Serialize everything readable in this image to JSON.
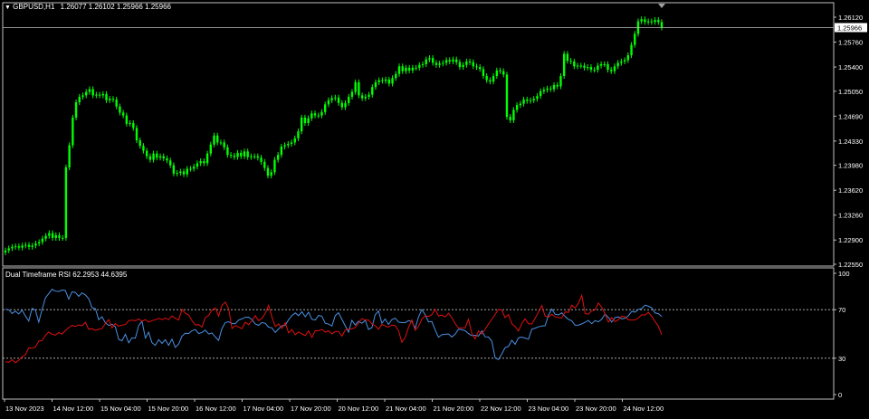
{
  "symbol_title": "GBPUSD,H1",
  "ohlc_text": "1.26077 1.26102 1.25966 1.25966",
  "price_axis_ticks": [
    "1.26120",
    "1.25760",
    "1.25400",
    "1.25050",
    "1.24690",
    "1.24330",
    "1.23980",
    "1.23620",
    "1.23260",
    "1.22900",
    "1.22550"
  ],
  "price_tick_values": [
    1.2612,
    1.2576,
    1.254,
    1.2505,
    1.2469,
    1.2433,
    1.2398,
    1.2362,
    1.2326,
    1.229,
    1.2255
  ],
  "current_price_label": "1.25966",
  "indicator_title": "Dual Timeframe RSI 62.2953 44.6395",
  "rsi_axis_ticks": [
    "100",
    "70",
    "30",
    "0"
  ],
  "time_axis_ticks": [
    "13 Nov 2023",
    "14 Nov 12:00",
    "15 Nov 04:00",
    "15 Nov 20:00",
    "16 Nov 12:00",
    "17 Nov 04:00",
    "17 Nov 20:00",
    "20 Nov 12:00",
    "21 Nov 04:00",
    "21 Nov 20:00",
    "22 Nov 12:00",
    "23 Nov 04:00",
    "23 Nov 20:00",
    "24 Nov 12:00"
  ],
  "colors": {
    "background": "#000000",
    "candles": "#00ff00",
    "rsi_fast": "#4a90e2",
    "rsi_slow": "#e01010",
    "grid": "#c0c0c0"
  },
  "chart_data": [
    {
      "type": "candlestick",
      "title": "GBPUSD,H1",
      "ylim": [
        1.2255,
        1.2625
      ],
      "x_range": [
        "13 Nov 2023",
        "24 Nov 2023"
      ],
      "close": [
        1.2275,
        1.2278,
        1.228,
        1.2281,
        1.2279,
        1.2282,
        1.2283,
        1.228,
        1.2282,
        1.2285,
        1.2287,
        1.2292,
        1.2296,
        1.23,
        1.2293,
        1.2297,
        1.2293,
        1.2293,
        1.2395,
        1.2427,
        1.2467,
        1.2489,
        1.2497,
        1.2499,
        1.2504,
        1.2508,
        1.2499,
        1.25,
        1.2499,
        1.2501,
        1.2492,
        1.2494,
        1.2493,
        1.2483,
        1.2474,
        1.247,
        1.2458,
        1.2459,
        1.2452,
        1.2434,
        1.2426,
        1.2419,
        1.2411,
        1.2406,
        1.2415,
        1.2409,
        1.2411,
        1.2408,
        1.2405,
        1.2398,
        1.2386,
        1.2387,
        1.2389,
        1.2385,
        1.2393,
        1.2393,
        1.2396,
        1.2401,
        1.2404,
        1.2401,
        1.2415,
        1.2428,
        1.2441,
        1.2431,
        1.2431,
        1.2424,
        1.2413,
        1.2412,
        1.241,
        1.2416,
        1.2411,
        1.2418,
        1.241,
        1.2411,
        1.2411,
        1.2409,
        1.2403,
        1.2394,
        1.2383,
        1.2388,
        1.2406,
        1.2413,
        1.2425,
        1.2427,
        1.2429,
        1.2431,
        1.2437,
        1.2447,
        1.2467,
        1.2459,
        1.2466,
        1.2473,
        1.247,
        1.247,
        1.2475,
        1.2486,
        1.2492,
        1.2495,
        1.2496,
        1.2488,
        1.2482,
        1.2488,
        1.2497,
        1.2504,
        1.2518,
        1.2499,
        1.2495,
        1.2497,
        1.25,
        1.2511,
        1.2518,
        1.2521,
        1.252,
        1.2522,
        1.2516,
        1.2524,
        1.253,
        1.2541,
        1.2534,
        1.2539,
        1.2535,
        1.2539,
        1.2539,
        1.2543,
        1.2544,
        1.2551,
        1.2553,
        1.2546,
        1.2543,
        1.2545,
        1.2546,
        1.255,
        1.2548,
        1.2551,
        1.2547,
        1.254,
        1.2543,
        1.2548,
        1.2547,
        1.2541,
        1.254,
        1.2537,
        1.2527,
        1.2521,
        1.2519,
        1.2527,
        1.2535,
        1.2534,
        1.2529,
        1.2468,
        1.2463,
        1.2478,
        1.2485,
        1.2487,
        1.2493,
        1.2491,
        1.2492,
        1.2494,
        1.2498,
        1.2505,
        1.2507,
        1.2509,
        1.2508,
        1.2514,
        1.2512,
        1.2527,
        1.2559,
        1.2549,
        1.2548,
        1.2541,
        1.2542,
        1.2542,
        1.2539,
        1.254,
        1.2536,
        1.2536,
        1.2542,
        1.2544,
        1.2544,
        1.2536,
        1.2534,
        1.2541,
        1.2546,
        1.2548,
        1.255,
        1.2557,
        1.2572,
        1.2588,
        1.2606,
        1.2609,
        1.2605,
        1.2606,
        1.2605,
        1.2608,
        1.2605,
        1.2597
      ]
    },
    {
      "type": "line",
      "title": "Dual Timeframe RSI 62.2953 44.6395",
      "ylim": [
        0,
        100
      ],
      "levels": [
        30,
        70
      ],
      "series": [
        {
          "name": "62.2953",
          "color": "#4a90e2",
          "values": [
            70.4,
            70.0,
            66.9,
            68.8,
            66.5,
            69.6,
            64.7,
            60.7,
            71.1,
            69.7,
            59.7,
            70.2,
            79.8,
            83.1,
            86.8,
            85.3,
            85.0,
            86.2,
            85.8,
            78.7,
            84.8,
            84.2,
            81.0,
            83.9,
            82.2,
            79.1,
            71.6,
            70.8,
            61.8,
            64.2,
            59.2,
            57.0,
            58.0,
            56.0,
            45.5,
            44.3,
            49.8,
            42.7,
            46.7,
            46.5,
            56.9,
            60.5,
            46.6,
            51.5,
            42.8,
            40.6,
            45.3,
            42.2,
            45.2,
            40.6,
            45.7,
            38.9,
            41.7,
            48.2,
            50.6,
            50.3,
            52.7,
            53.6,
            50.3,
            51.3,
            53.1,
            49.9,
            50.8,
            47.5,
            44.7,
            54.4,
            59.4,
            60.1,
            58.5,
            58.5,
            61.4,
            62.4,
            63.7,
            63.8,
            61.8,
            58.2,
            57.1,
            59.4,
            58.7,
            55.6,
            55.0,
            51.2,
            54.2,
            56.7,
            57.1,
            61.7,
            65.2,
            67.3,
            65.1,
            68.3,
            64.2,
            67.9,
            62.0,
            61.5,
            65.2,
            64.6,
            58.8,
            58.1,
            56.5,
            65.1,
            67.5,
            62.0,
            56.7,
            51.5,
            61.3,
            57.3,
            60.5,
            58.7,
            61.2,
            53.7,
            55.1,
            65.8,
            68.9,
            58.8,
            62.3,
            57.8,
            61.9,
            63.0,
            59.8,
            59.3,
            59.3,
            61.0,
            60.2,
            54.8,
            63.9,
            70.1,
            65.9,
            59.9,
            60.2,
            53.3,
            47.3,
            49.3,
            49.7,
            50.0,
            47.5,
            49.8,
            53.8,
            53.5,
            52.6,
            50.3,
            48.6,
            48.9,
            48.3,
            52.5,
            47.6,
            47.5,
            44.0,
            30.2,
            28.9,
            33.6,
            38.7,
            39.7,
            44.8,
            41.4,
            46.9,
            47.4,
            46.6,
            45.7,
            53.9,
            54.8,
            55.8,
            56.6,
            56.8,
            65.5,
            70.5,
            66.3,
            65.7,
            67.4,
            64.3,
            62.0,
            60.9,
            57.2,
            57.3,
            58.3,
            59.6,
            61.1,
            58.4,
            61.0,
            60.0,
            62.2,
            66.4,
            63.6,
            59.8,
            63.6,
            64.0,
            62.5,
            63.0,
            65.0,
            68.6,
            68.0,
            70.2,
            70.9,
            73.7,
            72.8,
            71.5,
            67.3,
            66.7,
            64.3
          ]
        },
        {
          "name": "44.6395",
          "color": "#e01010",
          "values": [
            27.0,
            26.6,
            28.8,
            26.3,
            28.3,
            31.1,
            32.9,
            38.6,
            38.2,
            39.1,
            44.1,
            44.6,
            48.8,
            51.6,
            49.8,
            49.0,
            51.1,
            49.9,
            52.7,
            55.2,
            57.1,
            56.2,
            57.4,
            56.7,
            59.6,
            53.8,
            54.3,
            52.9,
            53.8,
            54.4,
            58.6,
            61.9,
            55.0,
            58.6,
            56.4,
            57.3,
            57.7,
            60.9,
            61.4,
            60.8,
            62.4,
            60.4,
            61.9,
            59.8,
            61.0,
            61.7,
            62.8,
            61.8,
            63.0,
            61.8,
            64.8,
            62.8,
            61.6,
            70.3,
            67.1,
            65.7,
            60.9,
            57.4,
            57.7,
            55.7,
            63.5,
            65.3,
            69.8,
            71.5,
            64.6,
            73.6,
            76.2,
            70.8,
            54.5,
            56.9,
            55.7,
            54.4,
            59.7,
            57.6,
            60.9,
            65.1,
            61.0,
            62.8,
            67.0,
            73.6,
            64.0,
            56.1,
            58.2,
            54.6,
            59.3,
            50.9,
            53.6,
            49.3,
            51.7,
            50.0,
            48.7,
            52.5,
            47.2,
            52.7,
            52.6,
            53.8,
            51.5,
            52.6,
            50.0,
            52.0,
            52.1,
            48.2,
            53.2,
            54.0,
            54.3,
            55.2,
            59.0,
            62.6,
            61.4,
            61.5,
            58.4,
            56.7,
            53.8,
            57.9,
            56.6,
            55.6,
            57.3,
            56.9,
            52.7,
            43.1,
            47.0,
            55.4,
            61.6,
            53.0,
            56.2,
            62.2,
            65.1,
            64.3,
            66.0,
            70.3,
            64.9,
            65.5,
            64.0,
            67.1,
            63.5,
            58.6,
            54.9,
            54.9,
            55.0,
            62.2,
            50.6,
            46.0,
            52.5,
            49.9,
            53.8,
            58.1,
            62.0,
            66.1,
            70.3,
            69.6,
            63.4,
            66.0,
            58.5,
            56.0,
            52.4,
            58.6,
            62.5,
            58.5,
            58.1,
            62.9,
            68.0,
            73.4,
            64.7,
            63.9,
            66.2,
            64.1,
            63.4,
            63.3,
            68.2,
            67.7,
            73.7,
            71.4,
            75.2,
            81.8,
            66.9,
            66.3,
            69.2,
            69.7,
            75.5,
            71.9,
            66.4,
            59.7,
            63.5,
            60.1,
            61.7,
            64.6,
            64.2,
            61.6,
            61.5,
            61.6,
            63.1,
            65.8,
            65.5,
            67.9,
            64.4,
            60.3,
            56.4,
            49.3
          ]
        }
      ]
    }
  ]
}
